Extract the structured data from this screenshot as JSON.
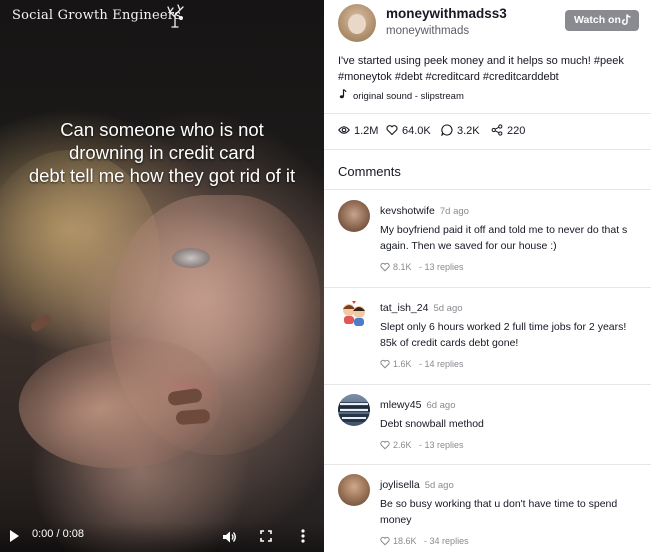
{
  "video": {
    "brand": "Social Growth Engineers",
    "overlay_lines": [
      "Can someone who is not",
      "drowning in credit card",
      "debt tell me how they got rid of it"
    ],
    "time": "0:00 / 0:08",
    "controls": [
      "play-icon",
      "volume-icon",
      "fullscreen-icon",
      "more-icon"
    ]
  },
  "author": {
    "username": "moneywithmadss3",
    "handle": "moneywithmads",
    "watch_label": "Watch on"
  },
  "caption": "I've started using peek money and it helps so much! #peek #moneytok #debt #creditcard #creditcarddebt",
  "sound": "original sound - slipstream",
  "stats": {
    "views": "1.2M",
    "likes": "64.0K",
    "comments": "3.2K",
    "shares": "220"
  },
  "comments_heading": "Comments",
  "comments": [
    {
      "name": "kevshotwife",
      "time": "7d ago",
      "text": "My boyfriend paid it off and told me to never do that s again. Then we saved for our house :)",
      "likes": "8.1K",
      "replies": "- 13 replies"
    },
    {
      "name": "tat_ish_24",
      "time": "5d ago",
      "text": "Slept only 6 hours worked 2 full time jobs for 2 years! 85k of credit cards debt gone!",
      "likes": "1.6K",
      "replies": "- 14 replies"
    },
    {
      "name": "mlewy45",
      "time": "6d ago",
      "text": "Debt snowball method",
      "likes": "2.6K",
      "replies": "- 13 replies"
    },
    {
      "name": "joylisella",
      "time": "5d ago",
      "text": "Be so busy working that u don't have time to spend money",
      "likes": "18.6K",
      "replies": "- 34 replies"
    }
  ]
}
